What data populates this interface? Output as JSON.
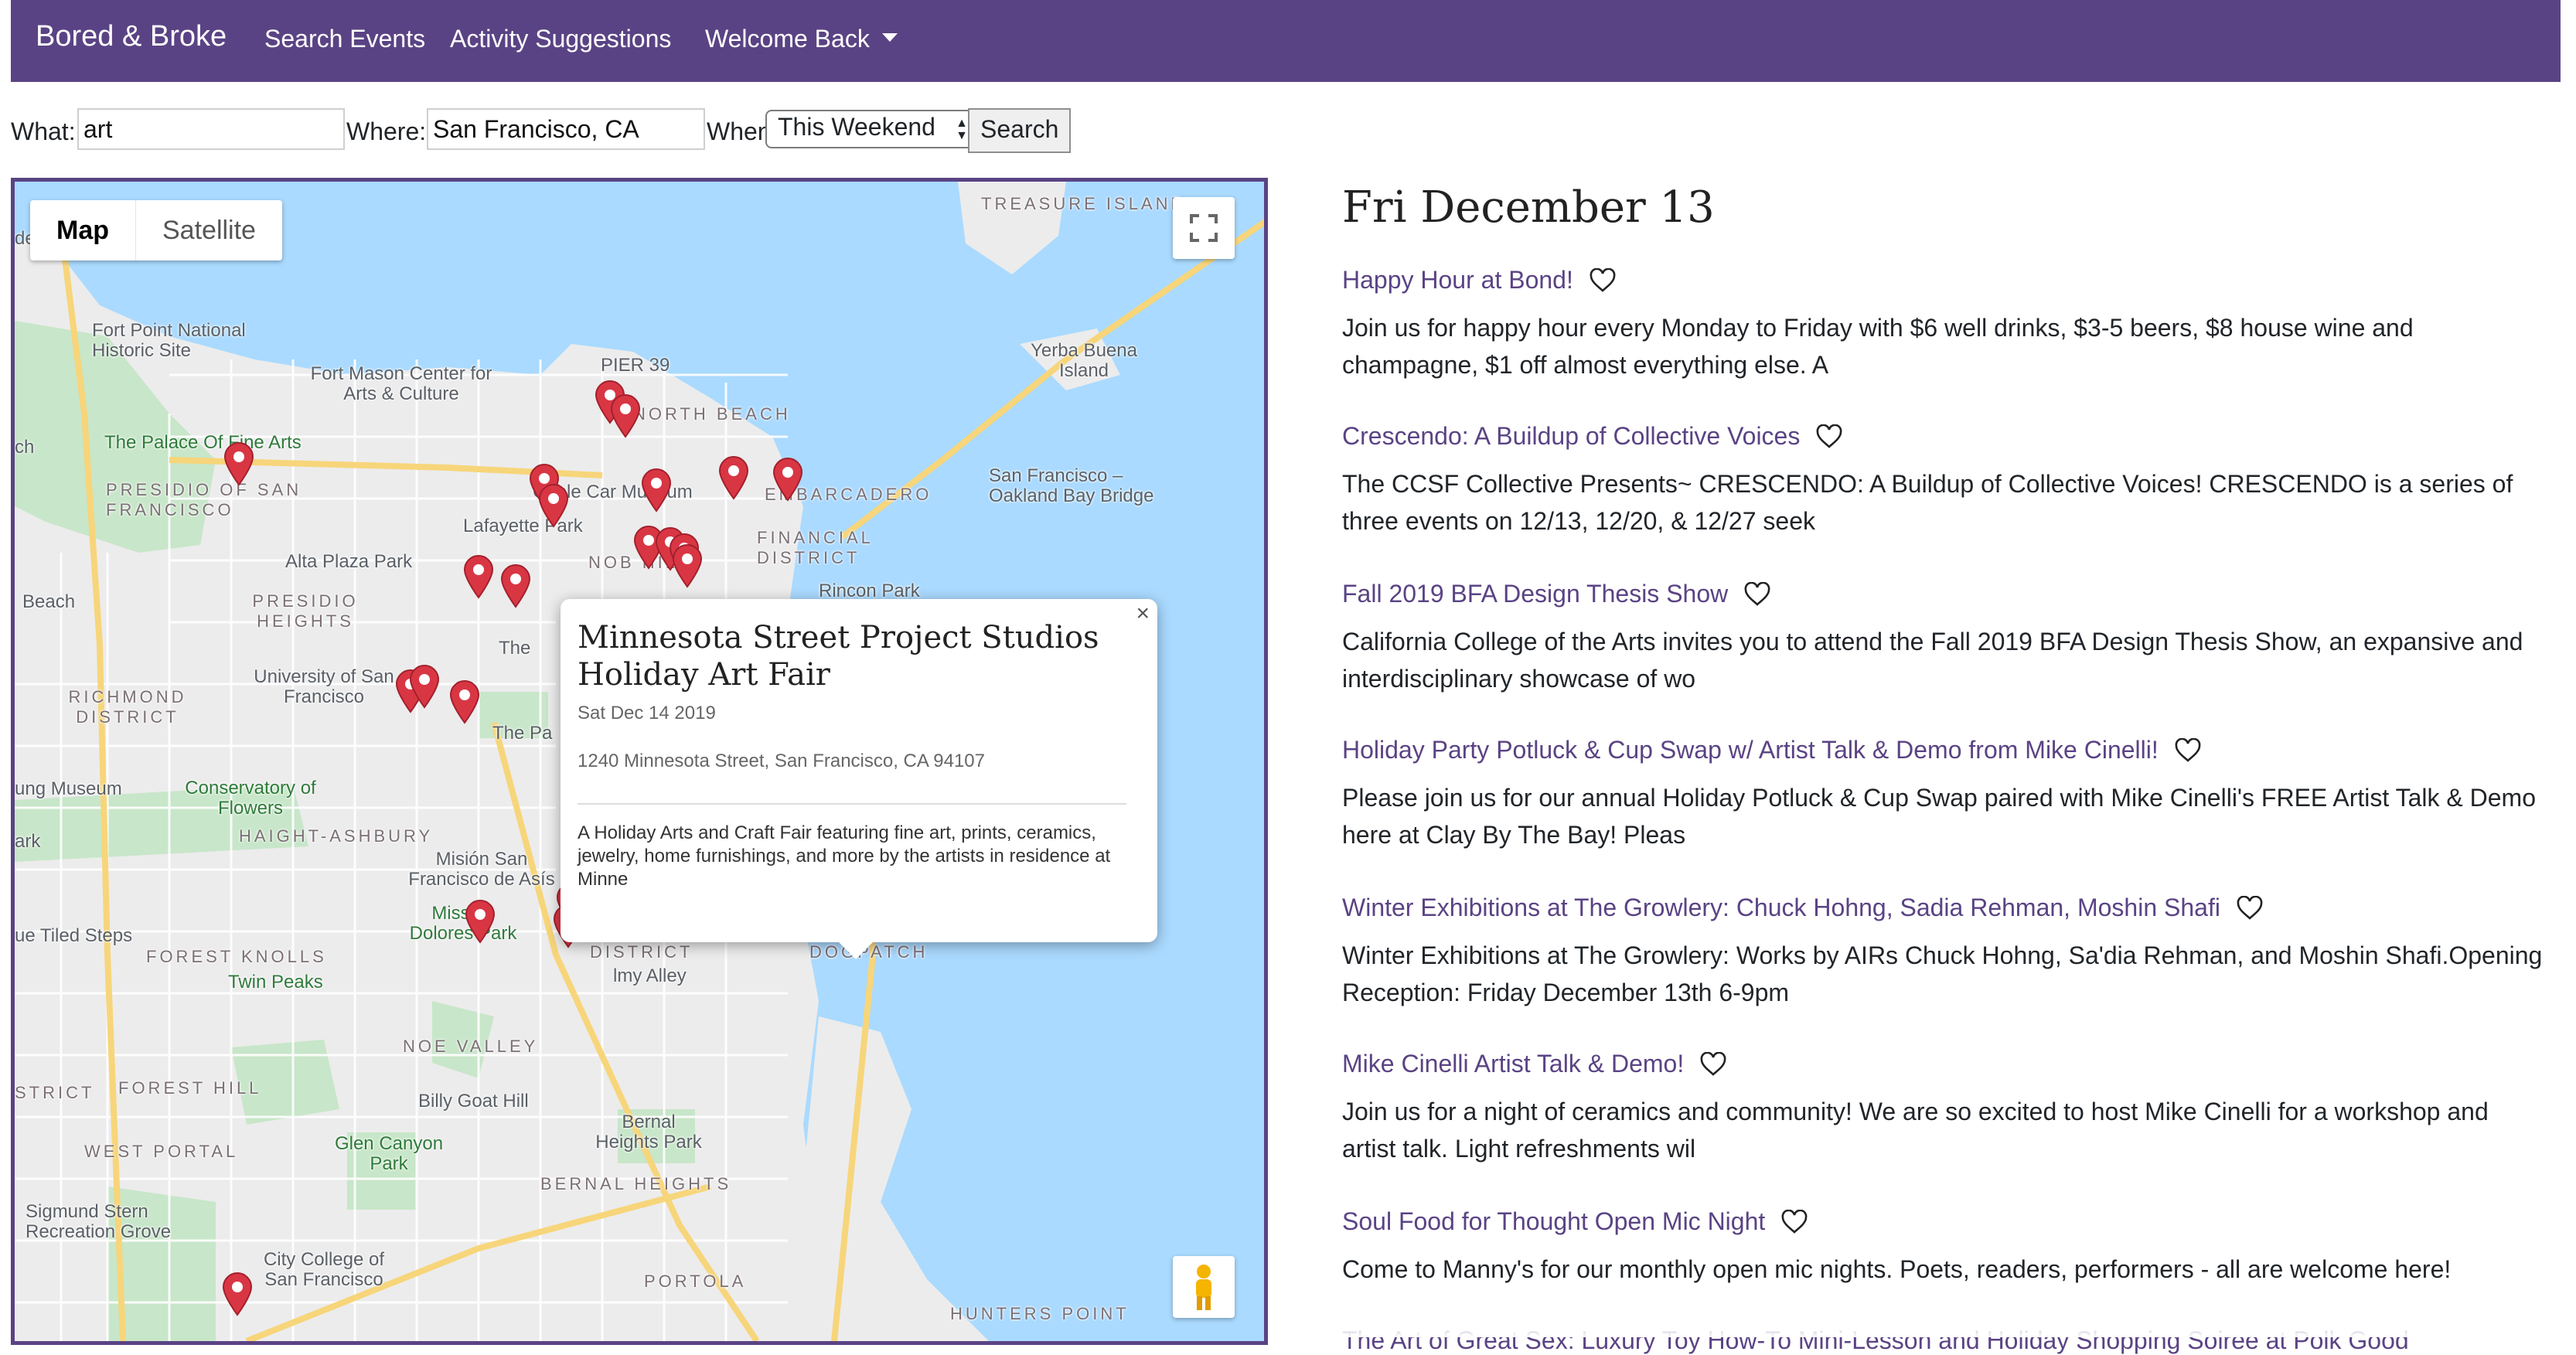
{
  "navbar": {
    "brand": "Bored & Broke",
    "links": [
      "Search Events",
      "Activity Suggestions",
      "Welcome Back"
    ]
  },
  "search": {
    "what_label": "What:",
    "what_value": "art",
    "where_label": "Where:",
    "where_value": "San Francisco, CA",
    "when_label": "When:",
    "when_value": "This Weekend",
    "button": "Search"
  },
  "map": {
    "type_buttons": [
      "Map",
      "Satellite"
    ],
    "selected_type": "Map",
    "labels": [
      "TREASURE ISLAND",
      "Fort Point National Historic Site",
      "Fort Mason Center for Arts & Culture",
      "PIER 39",
      "Yerba Buena Island",
      "NORTH BEACH",
      "The Palace Of Fine Arts",
      "PRESIDIO OF SAN FRANCISCO",
      "Cable Car Museum",
      "EMBARCADERO",
      "San Francisco – Oakland Bay Bridge",
      "Lafayette Park",
      "FINANCIAL DISTRICT",
      "Alta Plaza Park",
      "NOB HILL",
      "Rincon Park",
      "PRESIDIO HEIGHTS",
      "Beach",
      "RICHMOND DISTRICT",
      "University of San Francisco",
      "ung Museum",
      "Conservatory of Flowers",
      "HAIGHT-ASHBURY",
      "Misión San Francisco de Asís",
      "Mission Dolores Park",
      "ue Tiled Steps",
      "FOREST KNOLLS",
      "Twin Peaks",
      "DISTRICT",
      "lmy Alley",
      "DOGPATCH",
      "NOE VALLEY",
      "FOREST HILL",
      "Billy Goat Hill",
      "WEST PORTAL",
      "Glen Canyon Park",
      "Bernal Heights Park",
      "BERNAL HEIGHTS",
      "Sigmund Stern Recreation Grove",
      "City College of San Francisco",
      "PORTOLA",
      "HUNTERS POINT",
      "The Pa",
      "STRICT",
      "ark",
      "ch",
      "de",
      "The"
    ],
    "popup": {
      "title": "Minnesota Street Project Studios Holiday Art Fair",
      "date": "Sat Dec 14 2019",
      "address": "1240 Minnesota Street, San Francisco, CA 94107",
      "description": "A Holiday Arts and Craft Fair featuring fine art, prints, ceramics, jewelry, home furnishings, and more by the artists in residence at Minne",
      "close": "×"
    }
  },
  "events": {
    "day_heading": "Fri December 13",
    "items": [
      {
        "title": "Happy Hour at Bond!",
        "description": "Join us for happy hour every Monday to Friday with $6 well drinks, $3-5 beers, $8 house wine and champagne, $1 off almost everything else. A"
      },
      {
        "title": "Crescendo: A Buildup of Collective Voices",
        "description": "The CCSF Collective Presents~ CRESCENDO: A Buildup of Collective Voices! CRESCENDO is a series of three events on 12/13, 12/20, & 12/27 seek"
      },
      {
        "title": "Fall 2019 BFA Design Thesis Show",
        "description": "California College of the Arts invites you to attend the Fall 2019 BFA Design Thesis Show, an expansive and interdisciplinary showcase of wo"
      },
      {
        "title": "Holiday Party Potluck & Cup Swap w/ Artist Talk & Demo from Mike Cinelli!",
        "description": "Please join us for our annual Holiday Potluck & Cup Swap paired with Mike Cinelli's FREE Artist Talk & Demo here at Clay By The Bay!   Pleas"
      },
      {
        "title": "Winter Exhibitions at The Growlery: Chuck Hohng, Sadia Rehman, Moshin Shafi",
        "description": "Winter Exhibitions at The Growlery: Works by AIRs Chuck Hohng, Sa'dia Rehman, and Moshin Shafi.Opening Reception: Friday December 13th 6-9pm"
      },
      {
        "title": "Mike Cinelli Artist Talk & Demo!",
        "description": "Join us for a night of ceramics and community! We are so excited to host Mike Cinelli for a workshop and artist talk. Light refreshments wil"
      },
      {
        "title": "Soul Food for Thought Open Mic Night",
        "description": "Come to Manny's for our monthly open mic nights. Poets, readers, performers - all are welcome here!"
      },
      {
        "title": "The Art of Great Sex: Luxury Toy How-To Mini-Lesson and Holiday Shopping Soiree at Polk Good",
        "description": ""
      }
    ]
  },
  "colors": {
    "brand": "#5a4384",
    "marker": "#d93644",
    "water": "#aadaff",
    "park": "#c8e6c9"
  }
}
